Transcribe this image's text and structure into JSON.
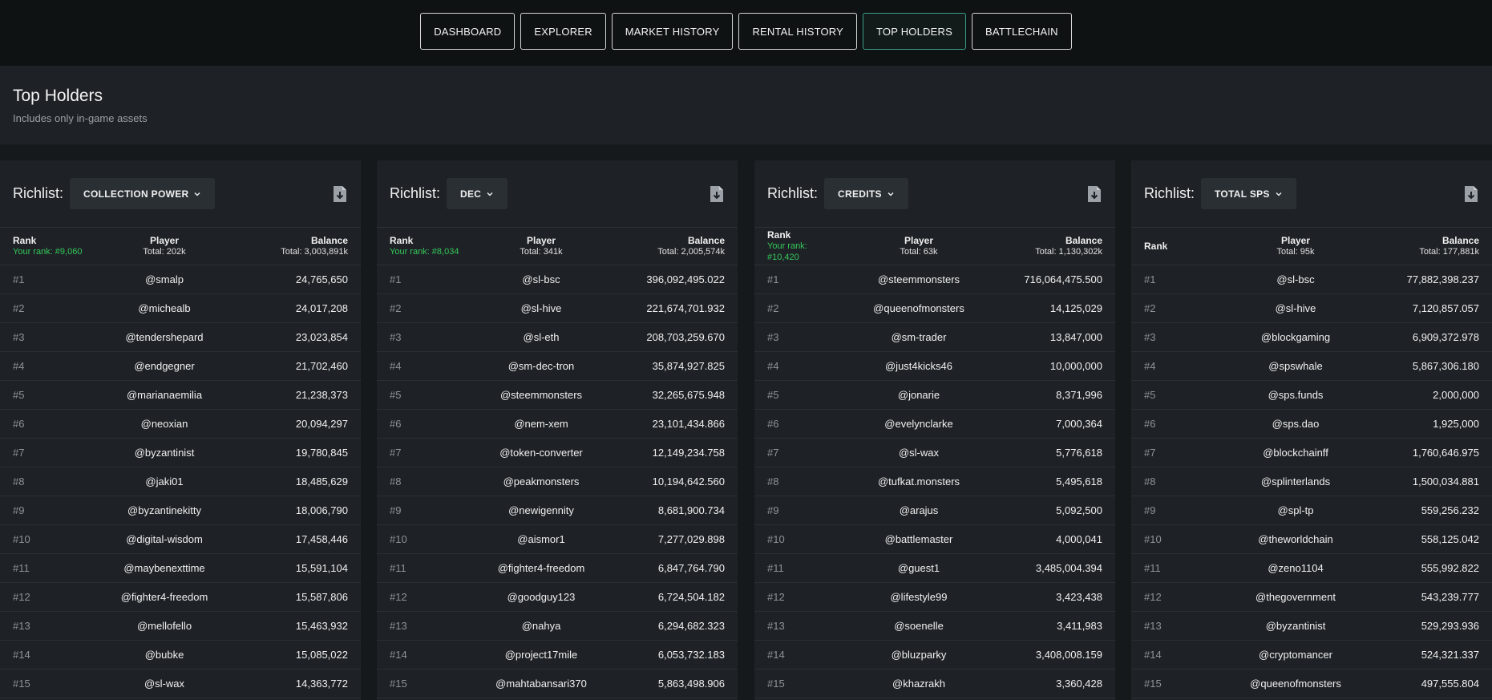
{
  "nav": {
    "items": [
      {
        "label": "DASHBOARD",
        "active": false
      },
      {
        "label": "EXPLORER",
        "active": false
      },
      {
        "label": "MARKET HISTORY",
        "active": false
      },
      {
        "label": "RENTAL HISTORY",
        "active": false
      },
      {
        "label": "TOP HOLDERS",
        "active": true
      },
      {
        "label": "BATTLECHAIN",
        "active": false
      }
    ]
  },
  "page": {
    "title": "Top Holders",
    "subtitle": "Includes only in-game assets"
  },
  "colors": {
    "accent_green": "#34c759",
    "active_border": "#3a9e8c",
    "panel_bg": "#1e2226"
  },
  "icons": {
    "download": "download-file-icon",
    "chevron": "chevron-down-icon"
  },
  "panels": [
    {
      "richlist_label": "Richlist:",
      "selected": "COLLECTION POWER",
      "header": {
        "rank": "Rank",
        "your_rank": "Your rank: #9,060",
        "player": "Player",
        "player_total": "Total: 202k",
        "balance": "Balance",
        "balance_total": "Total: 3,003,891k"
      },
      "rows": [
        {
          "rank": "#1",
          "player": "@smalp",
          "balance": "24,765,650"
        },
        {
          "rank": "#2",
          "player": "@michealb",
          "balance": "24,017,208"
        },
        {
          "rank": "#3",
          "player": "@tendershepard",
          "balance": "23,023,854"
        },
        {
          "rank": "#4",
          "player": "@endgegner",
          "balance": "21,702,460"
        },
        {
          "rank": "#5",
          "player": "@marianaemilia",
          "balance": "21,238,373"
        },
        {
          "rank": "#6",
          "player": "@neoxian",
          "balance": "20,094,297"
        },
        {
          "rank": "#7",
          "player": "@byzantinist",
          "balance": "19,780,845"
        },
        {
          "rank": "#8",
          "player": "@jaki01",
          "balance": "18,485,629"
        },
        {
          "rank": "#9",
          "player": "@byzantinekitty",
          "balance": "18,006,790"
        },
        {
          "rank": "#10",
          "player": "@digital-wisdom",
          "balance": "17,458,446"
        },
        {
          "rank": "#11",
          "player": "@maybenexttime",
          "balance": "15,591,104"
        },
        {
          "rank": "#12",
          "player": "@fighter4-freedom",
          "balance": "15,587,806"
        },
        {
          "rank": "#13",
          "player": "@mellofello",
          "balance": "15,463,932"
        },
        {
          "rank": "#14",
          "player": "@bubke",
          "balance": "15,085,022"
        },
        {
          "rank": "#15",
          "player": "@sl-wax",
          "balance": "14,363,772"
        }
      ]
    },
    {
      "richlist_label": "Richlist:",
      "selected": "DEC",
      "header": {
        "rank": "Rank",
        "your_rank": "Your rank: #8,034",
        "player": "Player",
        "player_total": "Total: 341k",
        "balance": "Balance",
        "balance_total": "Total: 2,005,574k"
      },
      "rows": [
        {
          "rank": "#1",
          "player": "@sl-bsc",
          "balance": "396,092,495.022"
        },
        {
          "rank": "#2",
          "player": "@sl-hive",
          "balance": "221,674,701.932"
        },
        {
          "rank": "#3",
          "player": "@sl-eth",
          "balance": "208,703,259.670"
        },
        {
          "rank": "#4",
          "player": "@sm-dec-tron",
          "balance": "35,874,927.825"
        },
        {
          "rank": "#5",
          "player": "@steemmonsters",
          "balance": "32,265,675.948"
        },
        {
          "rank": "#6",
          "player": "@nem-xem",
          "balance": "23,101,434.866"
        },
        {
          "rank": "#7",
          "player": "@token-converter",
          "balance": "12,149,234.758"
        },
        {
          "rank": "#8",
          "player": "@peakmonsters",
          "balance": "10,194,642.560"
        },
        {
          "rank": "#9",
          "player": "@newigennity",
          "balance": "8,681,900.734"
        },
        {
          "rank": "#10",
          "player": "@aismor1",
          "balance": "7,277,029.898"
        },
        {
          "rank": "#11",
          "player": "@fighter4-freedom",
          "balance": "6,847,764.790"
        },
        {
          "rank": "#12",
          "player": "@goodguy123",
          "balance": "6,724,504.182"
        },
        {
          "rank": "#13",
          "player": "@nahya",
          "balance": "6,294,682.323"
        },
        {
          "rank": "#14",
          "player": "@project17mile",
          "balance": "6,053,732.183"
        },
        {
          "rank": "#15",
          "player": "@mahtabansari370",
          "balance": "5,863,498.906"
        }
      ]
    },
    {
      "richlist_label": "Richlist:",
      "selected": "CREDITS",
      "header": {
        "rank": "Rank",
        "your_rank": "Your rank: #10,420",
        "player": "Player",
        "player_total": "Total: 63k",
        "balance": "Balance",
        "balance_total": "Total: 1,130,302k"
      },
      "rows": [
        {
          "rank": "#1",
          "player": "@steemmonsters",
          "balance": "716,064,475.500"
        },
        {
          "rank": "#2",
          "player": "@queenofmonsters",
          "balance": "14,125,029"
        },
        {
          "rank": "#3",
          "player": "@sm-trader",
          "balance": "13,847,000"
        },
        {
          "rank": "#4",
          "player": "@just4kicks46",
          "balance": "10,000,000"
        },
        {
          "rank": "#5",
          "player": "@jonarie",
          "balance": "8,371,996"
        },
        {
          "rank": "#6",
          "player": "@evelynclarke",
          "balance": "7,000,364"
        },
        {
          "rank": "#7",
          "player": "@sl-wax",
          "balance": "5,776,618"
        },
        {
          "rank": "#8",
          "player": "@tufkat.monsters",
          "balance": "5,495,618"
        },
        {
          "rank": "#9",
          "player": "@arajus",
          "balance": "5,092,500"
        },
        {
          "rank": "#10",
          "player": "@battlemaster",
          "balance": "4,000,041"
        },
        {
          "rank": "#11",
          "player": "@guest1",
          "balance": "3,485,004.394"
        },
        {
          "rank": "#12",
          "player": "@lifestyle99",
          "balance": "3,423,438"
        },
        {
          "rank": "#13",
          "player": "@soenelle",
          "balance": "3,411,983"
        },
        {
          "rank": "#14",
          "player": "@bluzparky",
          "balance": "3,408,008.159"
        },
        {
          "rank": "#15",
          "player": "@khazrakh",
          "balance": "3,360,428"
        }
      ]
    },
    {
      "richlist_label": "Richlist:",
      "selected": "TOTAL SPS",
      "header": {
        "rank": "Rank",
        "your_rank": "",
        "player": "Player",
        "player_total": "Total: 95k",
        "balance": "Balance",
        "balance_total": "Total: 177,881k"
      },
      "rows": [
        {
          "rank": "#1",
          "player": "@sl-bsc",
          "balance": "77,882,398.237"
        },
        {
          "rank": "#2",
          "player": "@sl-hive",
          "balance": "7,120,857.057"
        },
        {
          "rank": "#3",
          "player": "@blockgaming",
          "balance": "6,909,372.978"
        },
        {
          "rank": "#4",
          "player": "@spswhale",
          "balance": "5,867,306.180"
        },
        {
          "rank": "#5",
          "player": "@sps.funds",
          "balance": "2,000,000"
        },
        {
          "rank": "#6",
          "player": "@sps.dao",
          "balance": "1,925,000"
        },
        {
          "rank": "#7",
          "player": "@blockchainff",
          "balance": "1,760,646.975"
        },
        {
          "rank": "#8",
          "player": "@splinterlands",
          "balance": "1,500,034.881"
        },
        {
          "rank": "#9",
          "player": "@spl-tp",
          "balance": "559,256.232"
        },
        {
          "rank": "#10",
          "player": "@theworldchain",
          "balance": "558,125.042"
        },
        {
          "rank": "#11",
          "player": "@zeno1104",
          "balance": "555,992.822"
        },
        {
          "rank": "#12",
          "player": "@thegovernment",
          "balance": "543,239.777"
        },
        {
          "rank": "#13",
          "player": "@byzantinist",
          "balance": "529,293.936"
        },
        {
          "rank": "#14",
          "player": "@cryptomancer",
          "balance": "524,321.337"
        },
        {
          "rank": "#15",
          "player": "@queenofmonsters",
          "balance": "497,555.804"
        }
      ]
    }
  ]
}
